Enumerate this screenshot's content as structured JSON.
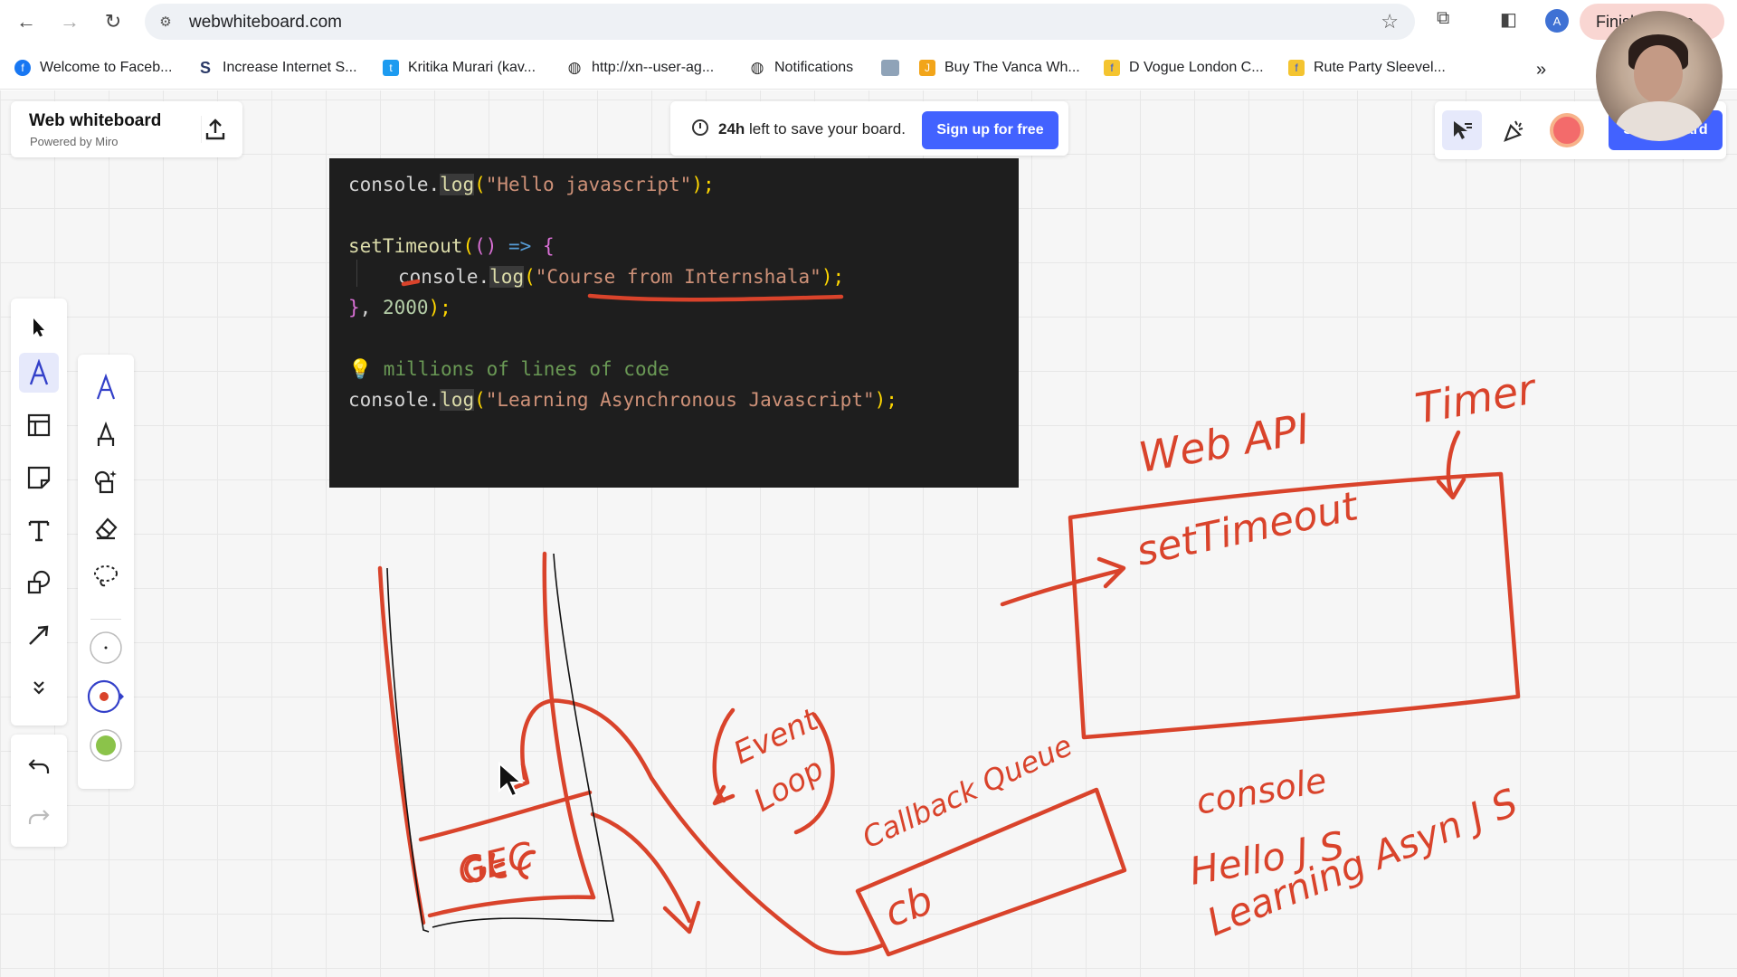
{
  "browser": {
    "url": "webwhiteboard.com",
    "profile_initial": "A",
    "finish_label": "Finish update",
    "bookmarks": [
      {
        "label": "Welcome to Faceb...",
        "color": "#1877f2",
        "glyph": "f"
      },
      {
        "label": "Increase Internet S...",
        "color": "#2b3a67",
        "glyph": "S"
      },
      {
        "label": "Kritika Murari (kav...",
        "color": "#1d9bf0",
        "glyph": "t"
      },
      {
        "label": "http://xn--user-ag...",
        "color": "#333333",
        "glyph": "◍"
      },
      {
        "label": "Notifications",
        "color": "#333333",
        "glyph": "◍"
      },
      {
        "label": "Buy The Vanca Wh...",
        "color": "#f2a51a",
        "glyph": "J"
      },
      {
        "label": "D Vogue London C...",
        "color": "#f4c430",
        "glyph": "f"
      },
      {
        "label": "Rute Party Sleevel...",
        "color": "#f4c430",
        "glyph": "f"
      }
    ]
  },
  "app": {
    "title": "Web whiteboard",
    "subtitle": "Powered by Miro",
    "save_notice_bold": "24h",
    "save_notice_rest": " left to save your board.",
    "signup_label": "Sign up for free",
    "share_label": "Share board"
  },
  "code": {
    "line1": {
      "obj": "console.",
      "fn": "log",
      "open": "(",
      "str": "\"Hello javascript\"",
      "close": ");"
    },
    "line2": {
      "fn": "setTimeout",
      "open": "(",
      "args": "() ",
      "arrow": "=> ",
      "brace": "{"
    },
    "line3": {
      "obj": "console.",
      "fn": "log",
      "open": "(",
      "str": "\"Course from Internshala\"",
      "close": ");"
    },
    "line4": {
      "brace": "}",
      "rest": ", ",
      "num": "2000",
      "close": ");"
    },
    "line5": {
      "icon": "💡",
      "comment": " millions of lines of code"
    },
    "line6": {
      "obj": "console.",
      "fn": "log",
      "open": "(",
      "str": "\"Learning Asynchronous Javascript\"",
      "close": ");"
    }
  },
  "sketch": {
    "ink_color": "#d9432b",
    "labels": {
      "web_api": "Web API",
      "timer": "Timer",
      "set_timeout": "setTimeout",
      "event_loop_1": "Event",
      "event_loop_2": "Loop",
      "callback_queue": "Callback Queue",
      "cb": "cb",
      "gec": "GEC",
      "console": "console",
      "console_line1": "Hello J S",
      "console_line2": "Learning Asyn J S"
    }
  },
  "colors": {
    "accent": "#4262ff",
    "ink": "#d9432b",
    "code_bg": "#1e1e1e"
  }
}
